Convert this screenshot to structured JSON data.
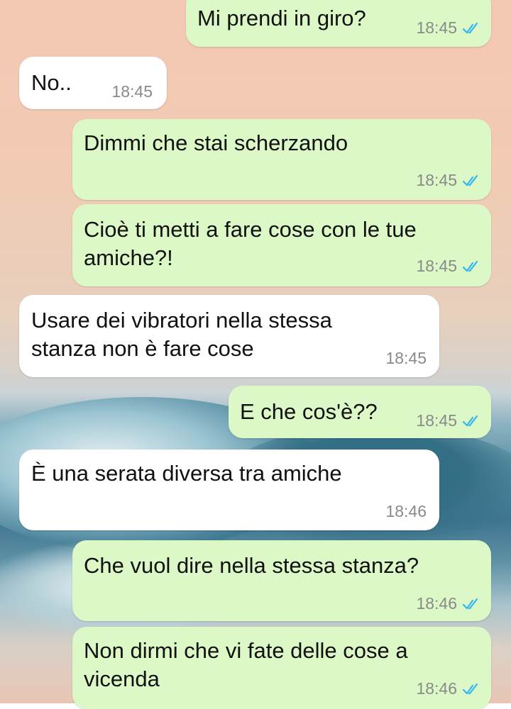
{
  "colors": {
    "outgoing_bubble": "#dcf8c6",
    "incoming_bubble": "#ffffff",
    "read_ticks": "#34b7f1"
  },
  "messages": [
    {
      "direction": "outgoing",
      "text": "Mi prendi in giro?",
      "time": "18:45",
      "status": "read"
    },
    {
      "direction": "incoming",
      "text": "No..",
      "time": "18:45"
    },
    {
      "direction": "outgoing",
      "text": "Dimmi che stai scherzando",
      "time": "18:45",
      "status": "read"
    },
    {
      "direction": "outgoing",
      "text": "Cioè ti metti a fare cose con le tue\namiche?!",
      "time": "18:45",
      "status": "read"
    },
    {
      "direction": "incoming",
      "text": "Usare dei vibratori nella stessa\nstanza non è fare cose",
      "time": "18:45"
    },
    {
      "direction": "outgoing",
      "text": "E che cos'è??",
      "time": "18:45",
      "status": "read"
    },
    {
      "direction": "incoming",
      "text": "È una serata diversa tra amiche",
      "time": "18:46"
    },
    {
      "direction": "outgoing",
      "text": "Che vuol dire nella stessa stanza?",
      "time": "18:46",
      "status": "read"
    },
    {
      "direction": "outgoing",
      "text": "Non dirmi che vi fate delle cose a\nvicenda",
      "time": "18:46",
      "status": "read"
    }
  ]
}
